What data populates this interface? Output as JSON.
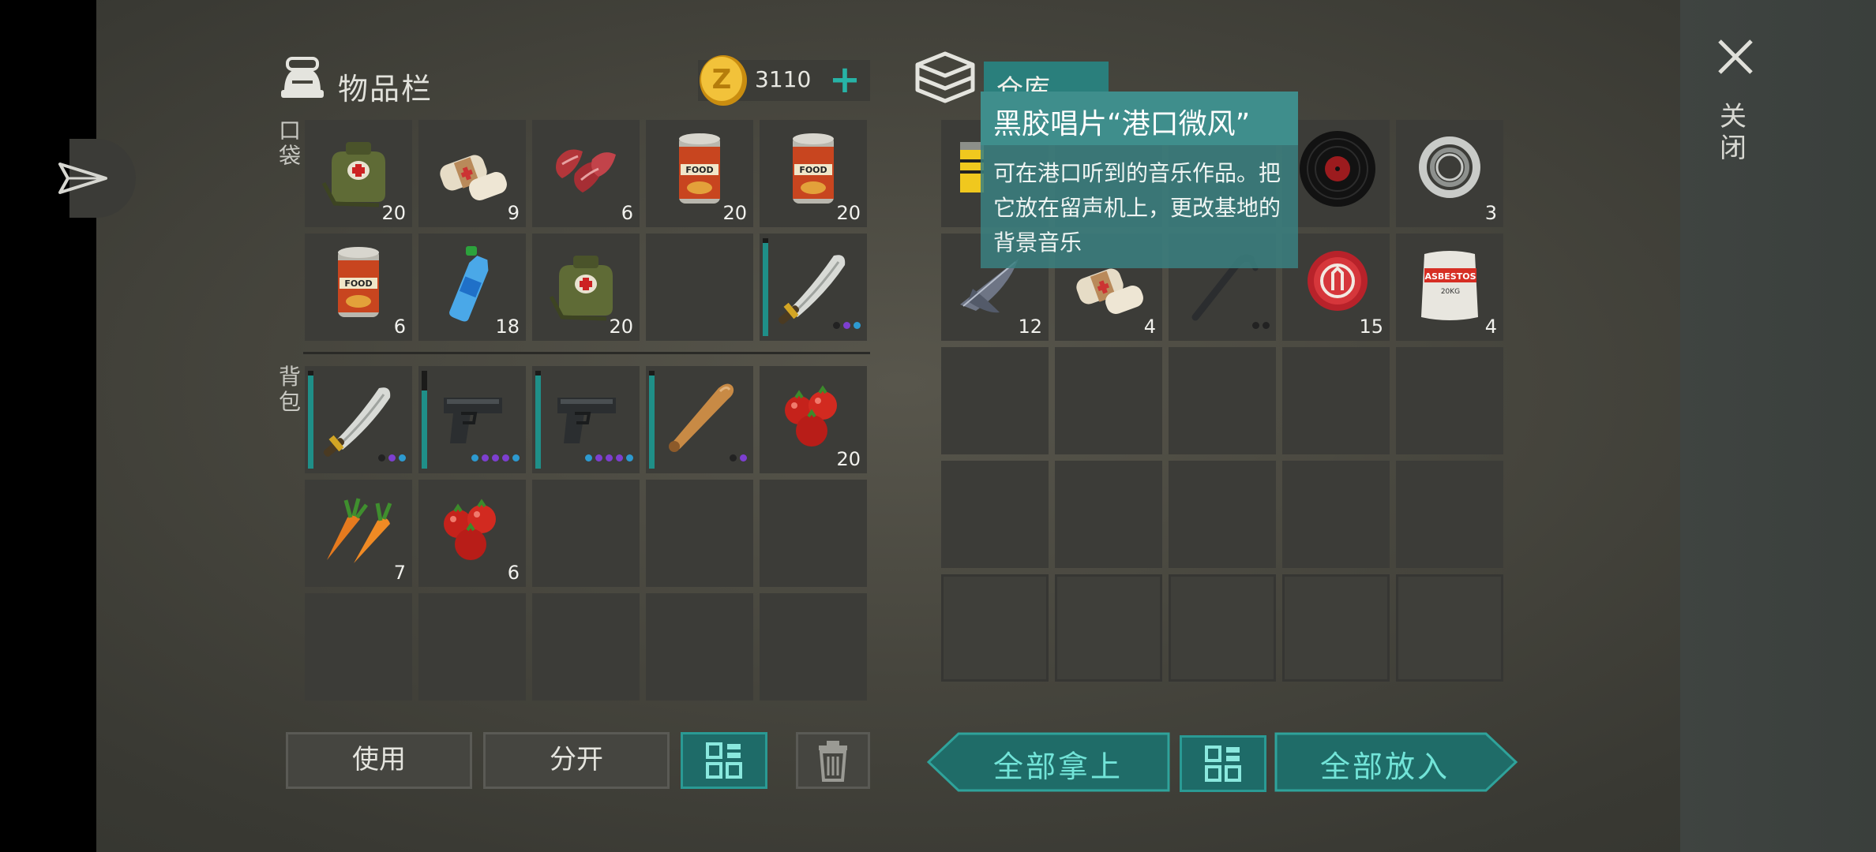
{
  "inventory": {
    "title": "物品栏",
    "coins": "3110",
    "section_pockets": "口袋",
    "section_backpack": "背包",
    "pocket_slots": [
      {
        "item": "medkit-bag",
        "qty": "20"
      },
      {
        "item": "bandage",
        "qty": "9"
      },
      {
        "item": "raw-meat",
        "qty": "6"
      },
      {
        "item": "canned-food",
        "qty": "20"
      },
      {
        "item": "canned-food",
        "qty": "20"
      },
      {
        "item": "canned-food",
        "qty": "6"
      },
      {
        "item": "water-bottle",
        "qty": "18"
      },
      {
        "item": "medkit-bag",
        "qty": "20"
      },
      {
        "item": "empty",
        "qty": ""
      },
      {
        "item": "machete",
        "qty": "",
        "durability": 0.95
      }
    ],
    "backpack_slots": [
      {
        "item": "machete",
        "qty": "",
        "durability": 0.95
      },
      {
        "item": "pistol",
        "qty": "",
        "durability": 0.8
      },
      {
        "item": "pistol",
        "qty": "",
        "durability": 0.95
      },
      {
        "item": "baseball-bat",
        "qty": "",
        "durability": 0.95
      },
      {
        "item": "tomatoes",
        "qty": "20"
      },
      {
        "item": "carrots",
        "qty": "7"
      },
      {
        "item": "tomatoes",
        "qty": "6"
      },
      {
        "item": "empty",
        "qty": ""
      },
      {
        "item": "empty",
        "qty": ""
      },
      {
        "item": "empty",
        "qty": ""
      },
      {
        "item": "empty",
        "qty": ""
      },
      {
        "item": "empty",
        "qty": ""
      },
      {
        "item": "empty",
        "qty": ""
      },
      {
        "item": "empty",
        "qty": ""
      },
      {
        "item": "empty",
        "qty": ""
      }
    ],
    "buttons": {
      "use": "使用",
      "split": "分开"
    }
  },
  "stash": {
    "tab_label": "仓库",
    "slots": [
      {
        "item": "yellow-can",
        "qty": ""
      },
      {
        "item": "hidden",
        "qty": ""
      },
      {
        "item": "hidden",
        "qty": ""
      },
      {
        "item": "vinyl-record",
        "qty": ""
      },
      {
        "item": "bearing",
        "qty": "3"
      },
      {
        "item": "bird-feather",
        "qty": "12"
      },
      {
        "item": "bandage",
        "qty": "4"
      },
      {
        "item": "crowbar",
        "qty": ""
      },
      {
        "item": "bottle-cap",
        "qty": "15"
      },
      {
        "item": "asbestos-sack",
        "qty": "4"
      }
    ],
    "buttons": {
      "take_all": "全部拿上",
      "put_all": "全部放入"
    }
  },
  "tooltip": {
    "title": "黑胶唱片“港口微风”",
    "description": "可在港口听到的音乐作品。把它放在留声机上，更改基地的背景音乐"
  },
  "close_label": "关闭",
  "colors": {
    "accent": "#27b3a6",
    "durability": "#1f8f88",
    "tier_purple": "#7d3fd0",
    "tier_blue": "#2d9ad0"
  }
}
